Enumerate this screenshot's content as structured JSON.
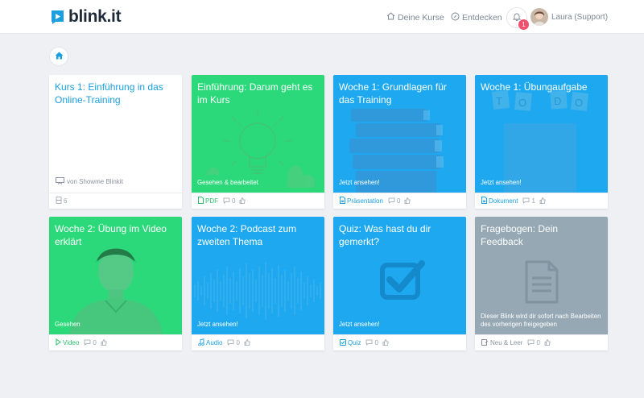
{
  "brand": {
    "name": "blink.it",
    "color": "#1a9fe0"
  },
  "nav": {
    "kurse_label": "Deine Kurse",
    "entdecken_label": "Entdecken",
    "notification_count": "1",
    "user_name": "Laura (Support)"
  },
  "colors": {
    "green": "#2bd97a",
    "blue": "#1da8f0",
    "grey": "#95a8b3",
    "accent_text": "#1a9fe0"
  },
  "cards": [
    {
      "title": "Kurs 1: Einführung in das Online-Training",
      "author": "von Showme Blinkit",
      "count": "6"
    },
    {
      "title": "Einführung: Darum geht es im Kurs",
      "status": "Gesehen & bearbeitet",
      "type": "PDF",
      "comments": "0",
      "icon": "lightbulb-icon"
    },
    {
      "title": "Woche 1: Grundlagen für das Training",
      "status": "Jetzt ansehen!",
      "type": "Präsentation",
      "comments": "0",
      "icon": "books-icon"
    },
    {
      "title": "Woche 1: Übungaufgabe",
      "status": "Jetzt ansehen!",
      "type": "Dokument",
      "comments": "1",
      "icon": "todo-icon"
    },
    {
      "title": "Woche 2: Übung im Video erklärt",
      "status": "Gesehen",
      "type": "Video",
      "comments": "0",
      "icon": "person-photo"
    },
    {
      "title": "Woche 2: Podcast zum zweiten Thema",
      "status": "Jetzt ansehen!",
      "type": "Audio",
      "comments": "0",
      "icon": "waveform-icon"
    },
    {
      "title": "Quiz: Was hast du dir gemerkt?",
      "status": "Jetzt ansehen!",
      "type": "Quiz",
      "comments": "0",
      "icon": "checkbox-icon"
    },
    {
      "title": "Fragebogen: Dein Feedback",
      "status": "Dieser Blink wird dir sofort nach Bearbeiten des vorherigen freigegeben",
      "type": "Neu & Leer",
      "comments": "0",
      "icon": "document-icon"
    }
  ]
}
